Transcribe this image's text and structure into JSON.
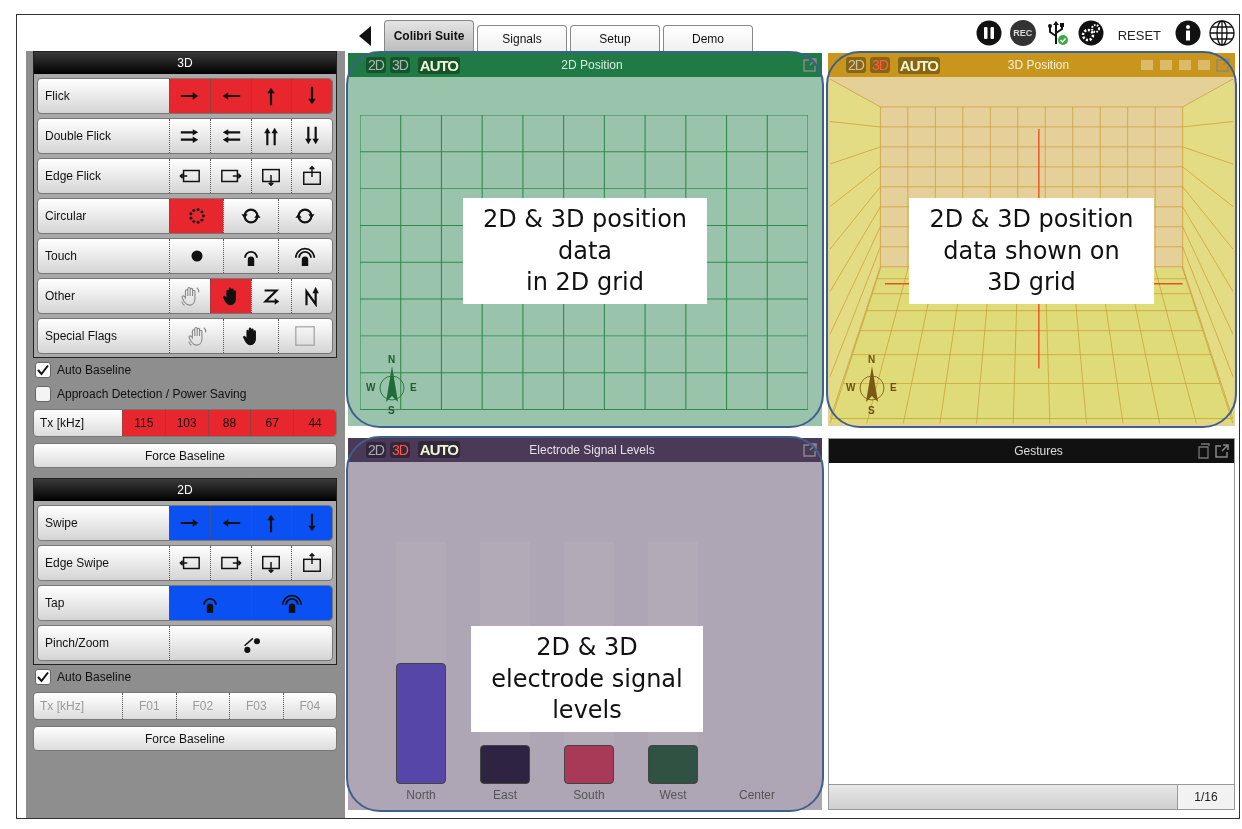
{
  "tabs": [
    {
      "label": "Colibri Suite",
      "selected": true
    },
    {
      "label": "Signals",
      "selected": false
    },
    {
      "label": "Setup",
      "selected": false
    },
    {
      "label": "Demo",
      "selected": false
    }
  ],
  "toolbar": {
    "record": "REC",
    "reset": "RESET"
  },
  "sections": [
    {
      "title": "3D",
      "color": "#e8262e",
      "rows": [
        {
          "label": "Flick",
          "cells": [
            {
              "kind": "right",
              "on": true
            },
            {
              "kind": "left",
              "on": true
            },
            {
              "kind": "up",
              "on": true
            },
            {
              "kind": "down",
              "on": true
            }
          ]
        },
        {
          "label": "Double Flick",
          "cells": [
            {
              "kind": "dright",
              "on": false
            },
            {
              "kind": "dleft",
              "on": false
            },
            {
              "kind": "dup",
              "on": false
            },
            {
              "kind": "ddown",
              "on": false
            }
          ]
        },
        {
          "label": "Edge Flick",
          "cells": [
            {
              "kind": "edge-left",
              "on": false
            },
            {
              "kind": "edge-right",
              "on": false
            },
            {
              "kind": "edge-bottom",
              "on": false
            },
            {
              "kind": "edge-top",
              "on": false
            }
          ]
        },
        {
          "label": "Circular",
          "cells": [
            {
              "kind": "dots",
              "on": true
            },
            {
              "kind": "cw",
              "on": false
            },
            {
              "kind": "ccw",
              "on": false
            }
          ]
        },
        {
          "label": "Touch",
          "cells": [
            {
              "kind": "dot",
              "on": false
            },
            {
              "kind": "tap",
              "on": false
            },
            {
              "kind": "dtap",
              "on": false
            }
          ]
        },
        {
          "label": "Other",
          "cells": [
            {
              "kind": "wave",
              "on": false
            },
            {
              "kind": "hand",
              "on": true
            },
            {
              "kind": "z",
              "on": false
            },
            {
              "kind": "n",
              "on": false
            }
          ]
        },
        {
          "label": "Special Flags",
          "cells": [
            {
              "kind": "wave",
              "on": false
            },
            {
              "kind": "hand",
              "on": false
            },
            {
              "kind": "box",
              "on": false
            }
          ]
        }
      ],
      "checkboxes": [
        {
          "label": "Auto Baseline",
          "checked": true
        },
        {
          "label": "Approach Detection / Power Saving",
          "checked": false
        }
      ],
      "tx": {
        "label": "Tx [kHz]",
        "disabled": false,
        "values": [
          {
            "text": "115",
            "on": true
          },
          {
            "text": "103",
            "on": true
          },
          {
            "text": "88",
            "on": true
          },
          {
            "text": "67",
            "on": true
          },
          {
            "text": "44",
            "on": true
          }
        ]
      },
      "button": "Force Baseline"
    },
    {
      "title": "2D",
      "color": "#0a50f2",
      "rows": [
        {
          "label": "Swipe",
          "cells": [
            {
              "kind": "right",
              "on": true
            },
            {
              "kind": "left",
              "on": true
            },
            {
              "kind": "up",
              "on": true
            },
            {
              "kind": "down",
              "on": true
            }
          ]
        },
        {
          "label": "Edge Swipe",
          "cells": [
            {
              "kind": "edge-left",
              "on": false
            },
            {
              "kind": "edge-right",
              "on": false
            },
            {
              "kind": "edge-bottom",
              "on": false
            },
            {
              "kind": "edge-top",
              "on": false
            }
          ]
        },
        {
          "label": "Tap",
          "cells": [
            {
              "kind": "tap",
              "on": true
            },
            {
              "kind": "dtap",
              "on": true
            }
          ]
        },
        {
          "label": "Pinch/Zoom",
          "cells": [
            {
              "kind": "pinch",
              "on": false
            }
          ]
        }
      ],
      "checkboxes": [
        {
          "label": "Auto Baseline",
          "checked": true
        }
      ],
      "tx": {
        "label": "Tx [kHz]",
        "disabled": true,
        "values": [
          {
            "text": "F01",
            "on": false
          },
          {
            "text": "F02",
            "on": false
          },
          {
            "text": "F03",
            "on": false
          },
          {
            "text": "F04",
            "on": false
          }
        ]
      },
      "button": "Force Baseline"
    }
  ],
  "panels": [
    {
      "title": "2D Position",
      "kind": "grid-2d",
      "color": "#1f7a45",
      "modes": [
        {
          "label": "2D",
          "selected": false
        },
        {
          "label": "3D",
          "selected": false
        },
        {
          "label": "AUTO",
          "selected": true
        }
      ],
      "compass": [
        "N",
        "W",
        "E",
        "S"
      ],
      "callout": "2D & 3D position\ndata\nin 2D grid"
    },
    {
      "title": "3D Position",
      "kind": "grid-3d",
      "color": "#c8961c",
      "modes": [
        {
          "label": "2D",
          "selected": false
        },
        {
          "label": "3D",
          "selected": true
        },
        {
          "label": "AUTO",
          "selected": true
        }
      ],
      "compass": [
        "N",
        "W",
        "E",
        "S"
      ],
      "callout": "2D & 3D position\ndata shown on\n3D grid"
    },
    {
      "title": "Electrode Signal Levels",
      "kind": "bars",
      "color": "#4a3a58",
      "modes": [
        {
          "label": "2D",
          "selected": false
        },
        {
          "label": "3D",
          "selected": true
        },
        {
          "label": "AUTO",
          "selected": true
        }
      ],
      "callout": "2D & 3D\nelectrode  signal\nlevels",
      "bars": [
        {
          "label": "North",
          "color": "#5646a8",
          "level": 0.5
        },
        {
          "label": "East",
          "color": "#2e2442",
          "level": 0.16
        },
        {
          "label": "South",
          "color": "#a83a58",
          "level": 0.16
        },
        {
          "label": "West",
          "color": "#2f5242",
          "level": 0.16
        },
        {
          "label": "Center"
        }
      ]
    },
    {
      "title": "Gestures",
      "kind": "list",
      "color": "#111111",
      "counter": "1/16"
    }
  ]
}
